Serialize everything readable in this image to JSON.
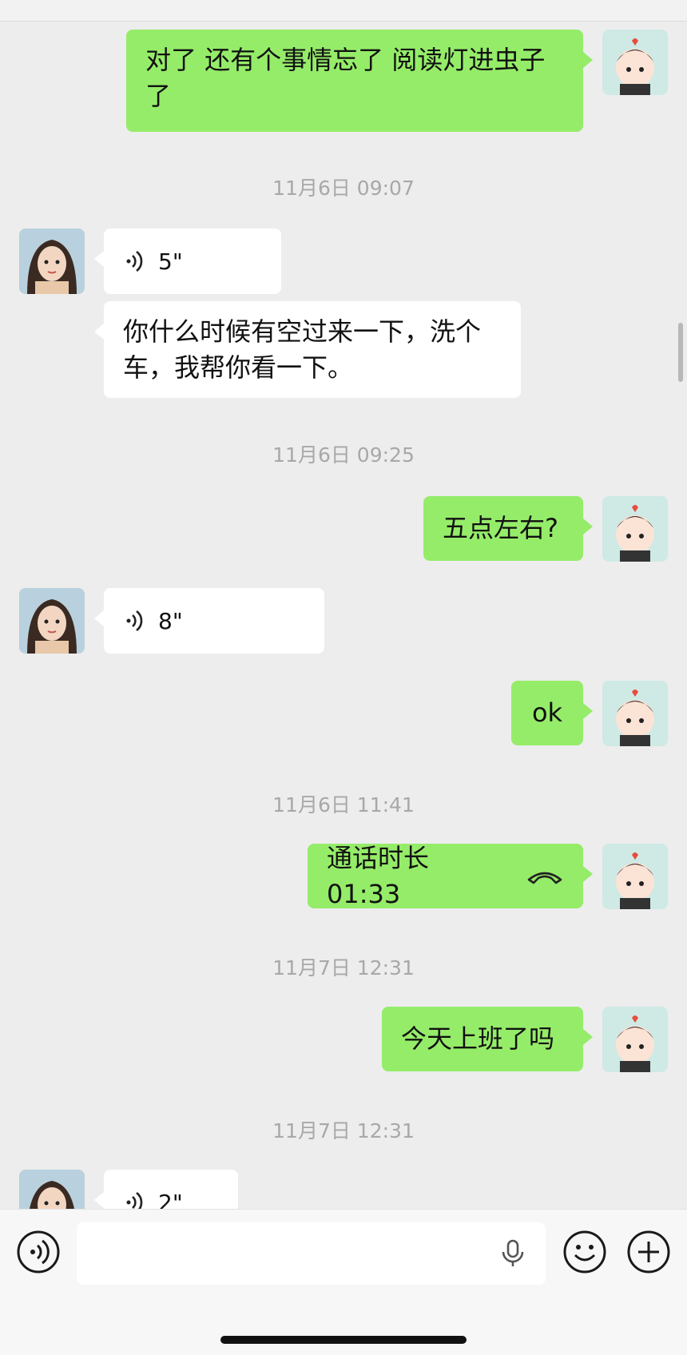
{
  "messages": [
    {
      "type": "text",
      "from": "me",
      "text": "对了 还有个事情忘了 阅读灯进虫子了"
    },
    {
      "type": "timestamp",
      "text": "11月6日 09:07"
    },
    {
      "type": "voice",
      "from": "her",
      "duration": "5\""
    },
    {
      "type": "text",
      "from": "her",
      "text": "你什么时候有空过来一下，洗个车，我帮你看一下。"
    },
    {
      "type": "timestamp",
      "text": "11月6日 09:25"
    },
    {
      "type": "text",
      "from": "me",
      "text": "五点左右?"
    },
    {
      "type": "voice",
      "from": "her",
      "duration": "8\""
    },
    {
      "type": "text",
      "from": "me",
      "text": "ok"
    },
    {
      "type": "timestamp",
      "text": "11月6日 11:41"
    },
    {
      "type": "call",
      "from": "me",
      "text": "通话时长 01:33",
      "icon": "phone-hangup-icon"
    },
    {
      "type": "timestamp",
      "text": "11月7日 12:31"
    },
    {
      "type": "text",
      "from": "me",
      "text": "今天上班了吗"
    },
    {
      "type": "timestamp",
      "text": "11月7日 12:31"
    },
    {
      "type": "voice",
      "from": "her",
      "duration": "2\""
    }
  ],
  "input_bar": {
    "left_icon": "voice-mode-icon",
    "field_icon": "microphone-icon",
    "emoji_icon": "emoji-icon",
    "plus_icon": "plus-icon"
  },
  "colors": {
    "background": "#ededed",
    "my_bubble": "#95ec69",
    "her_bubble": "#ffffff",
    "timestamp_text": "#a8a8a8"
  }
}
